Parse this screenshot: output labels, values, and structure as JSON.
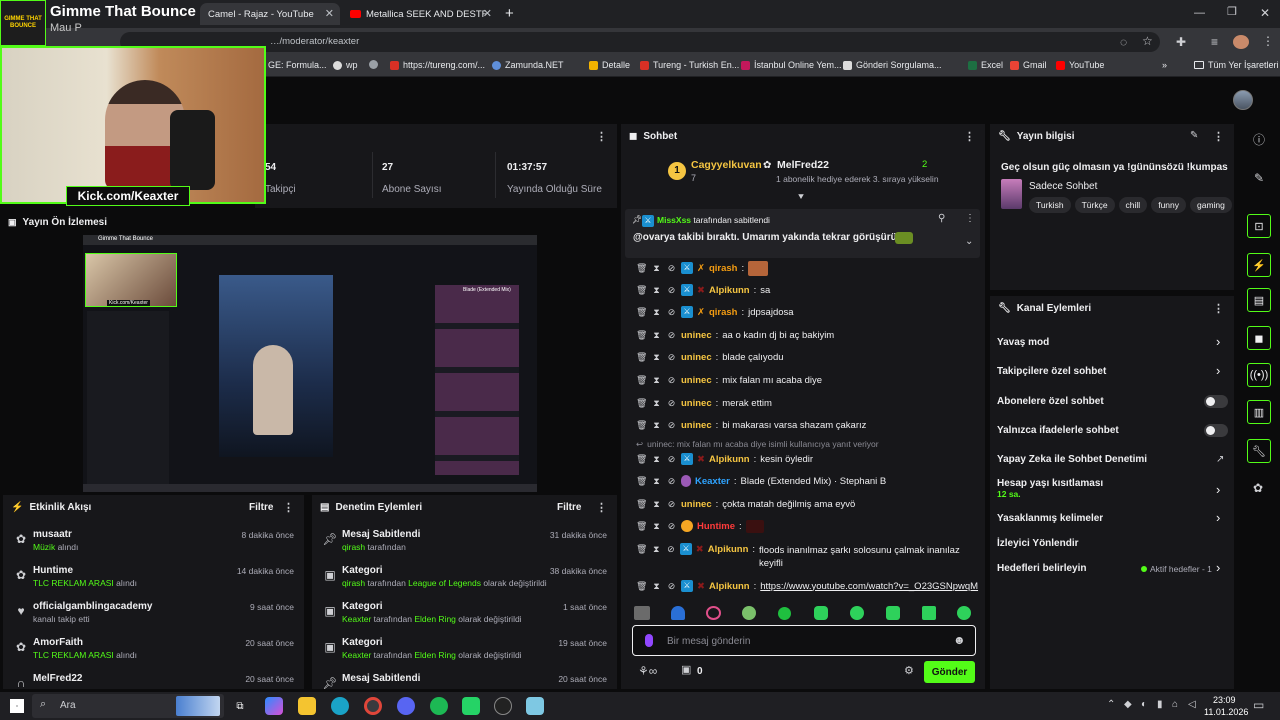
{
  "browser": {
    "tabs": [
      {
        "title": "Camel - Rajaz - YouTube",
        "active": true
      },
      {
        "title": "Metallica SEEK AND DESTR",
        "active": false
      }
    ],
    "address": "…/moderator/keaxter",
    "bookmarks": [
      "GE: Formula...",
      "wp",
      "",
      "https://tureng.com/...",
      "Zamunda.NET",
      "Detalle",
      "Tureng - Turkish En...",
      "İstanbul Online Yem...",
      "Gönderi Sorgulama...",
      "Excel",
      "Gmail",
      "YouTube"
    ],
    "bookmarks_all": "Tüm Yer İşaretleri"
  },
  "overlay": {
    "stream_title": "Gimme That Bounce",
    "streamer": "Mau P",
    "logo_text": "GIMME THAT BOUNCE",
    "cam_caption": "Kick.com/Keaxter"
  },
  "stats": [
    {
      "label": "Takipçi",
      "value": "54"
    },
    {
      "label": "Abone Sayısı",
      "value": "27"
    },
    {
      "label": "Yayında Olduğu Süre",
      "value": "01:37:57"
    }
  ],
  "preview": {
    "title": "Yayın Ön İzlemesi",
    "mini_title": "Gimme That Bounce",
    "mini_caption": "Kick.com/Keaxter",
    "side_label": "Blade (Extended Mix)"
  },
  "activity": {
    "title": "Etkinlik Akışı",
    "filter": "Filtre",
    "items": [
      {
        "icon": "gift-icon",
        "name": "musaatr",
        "sub_hl": "Müzik",
        "sub": " alındı",
        "time": "8 dakika önce"
      },
      {
        "icon": "gift-icon",
        "name": "Huntime",
        "sub_hl": "TLC REKLAM ARASI",
        "sub": " alındı",
        "time": "14 dakika önce"
      },
      {
        "icon": "heart-icon",
        "name": "officialgamblingacademy",
        "sub_hl": "",
        "sub": "kanalı takip etti",
        "time": "9 saat önce"
      },
      {
        "icon": "gift-icon",
        "name": "AmorFaith",
        "sub_hl": "TLC REKLAM ARASI",
        "sub": " alındı",
        "time": "20 saat önce"
      },
      {
        "icon": "headphones-icon",
        "name": "MelFred22",
        "sub_hl": "",
        "sub": "",
        "time": "20 saat önce"
      }
    ]
  },
  "moderation": {
    "title": "Denetim Eylemleri",
    "filter": "Filtre",
    "items": [
      {
        "icon": "pin-icon",
        "name": "Mesaj Sabitlendi",
        "who": "qirash",
        "mid": " tarafından",
        "obj": "",
        "tail": "",
        "time": "31 dakika önce"
      },
      {
        "icon": "category-icon",
        "name": "Kategori",
        "who": "qirash",
        "mid": " tarafından ",
        "obj": "League of Legends",
        "tail": " olarak değiştirildi",
        "time": "38 dakika önce"
      },
      {
        "icon": "category-icon",
        "name": "Kategori",
        "who": "Keaxter",
        "mid": " tarafından ",
        "obj": "Elden Ring",
        "tail": " olarak değiştirildi",
        "time": "1 saat önce"
      },
      {
        "icon": "category-icon",
        "name": "Kategori",
        "who": "Keaxter",
        "mid": " tarafından ",
        "obj": "Elden Ring",
        "tail": " olarak değiştirildi",
        "time": "19 saat önce"
      },
      {
        "icon": "pin-icon",
        "name": "Mesaj Sabitlendi",
        "who": "",
        "mid": "",
        "obj": "",
        "tail": "",
        "time": "20 saat önce"
      }
    ]
  },
  "chat": {
    "title": "Sohbet",
    "top_gifters": [
      {
        "rank": "1",
        "name": "Cagyyelkuvan",
        "count": "7"
      },
      {
        "name": "MelFred22",
        "count": "2",
        "note": "1 abonelik hediye ederek 3. sıraya yükselin"
      }
    ],
    "pinned": {
      "by": "MissXss",
      "by_suffix": " tarafından sabitlendi",
      "text": "@ovarya takibi bıraktı. Umarım yakında tekrar görüşürüz."
    },
    "messages": [
      {
        "user": "qirash",
        "color": "#f39c12",
        "text": ""
      },
      {
        "user": "Alpikunn",
        "color": "#f5c542",
        "text": "sa"
      },
      {
        "user": "qirash",
        "color": "#f39c12",
        "text": "jdpsajdosa"
      },
      {
        "user": "uninec",
        "color": "#f5c542",
        "text": "aa o kadın dj bi aç bakiyim"
      },
      {
        "user": "uninec",
        "color": "#f5c542",
        "text": "blade çalıyodu"
      },
      {
        "user": "uninec",
        "color": "#f5c542",
        "text": "mix falan mı acaba diye"
      },
      {
        "user": "uninec",
        "color": "#f5c542",
        "text": "merak ettim"
      },
      {
        "user": "uninec",
        "color": "#f5c542",
        "text": "bi makarası varsa shazam çakarız"
      },
      {
        "user": "Alpikunn",
        "color": "#f5c542",
        "text": "kesin öyledir"
      },
      {
        "user": "Keaxter",
        "color": "#2ea3ff",
        "text": "Blade (Extended Mix) · Stephani B"
      },
      {
        "user": "uninec",
        "color": "#f5c542",
        "text": "çokta matah değilmiş ama eyvö"
      },
      {
        "user": "Huntime",
        "color": "#ff3b3b",
        "text": ""
      },
      {
        "user": "Alpikunn",
        "color": "#f5c542",
        "text": "floods inanılmaz şarkı solosunu çalmak inanılaz keyifli"
      },
      {
        "user": "Alpikunn",
        "color": "#f5c542",
        "text": "https://www.youtube.com/watch?v=_O23GSNpwqM"
      }
    ],
    "reply_note": "uninec: mix falan mı acaba diye isimli kullanıcıya yanıt veriyor",
    "input_placeholder": "Bir mesaj gönderin",
    "send": "Gönder",
    "count": "0"
  },
  "stream_info": {
    "title": "Yayın bilgisi",
    "stream_title": "Geç olsun güç olmasın ya !gününsözü !kumpas",
    "category": "Sadece Sohbet",
    "tags": [
      "Turkish",
      "Türkçe",
      "chill",
      "funny",
      "gaming"
    ]
  },
  "channel_actions": {
    "title": "Kanal Eylemleri",
    "items": [
      {
        "label": "Yavaş mod",
        "kind": "chevron"
      },
      {
        "label": "Takipçilere özel sohbet",
        "kind": "chevron"
      },
      {
        "label": "Abonelere özel sohbet",
        "kind": "toggle"
      },
      {
        "label": "Yalnızca ifadelerle sohbet",
        "kind": "toggle"
      },
      {
        "label": "Yapay Zeka ile Sohbet Denetimi",
        "kind": "external"
      },
      {
        "label": "Hesap yaşı kısıtlaması",
        "kind": "chevron",
        "sub": "12 sa."
      },
      {
        "label": "Yasaklanmış kelimeler",
        "kind": "chevron"
      },
      {
        "label": "İzleyici Yönlendir",
        "kind": "none"
      },
      {
        "label": "Hedefleri belirleyin",
        "kind": "chevron",
        "extra": "Aktif hedefler - 1"
      }
    ]
  },
  "taskbar": {
    "search": "Ara",
    "time": "23:09",
    "date": "11.01.2026"
  },
  "colors": {
    "accent": "#53fc18",
    "panel": "#17171a",
    "bg": "#0b0b0c"
  }
}
